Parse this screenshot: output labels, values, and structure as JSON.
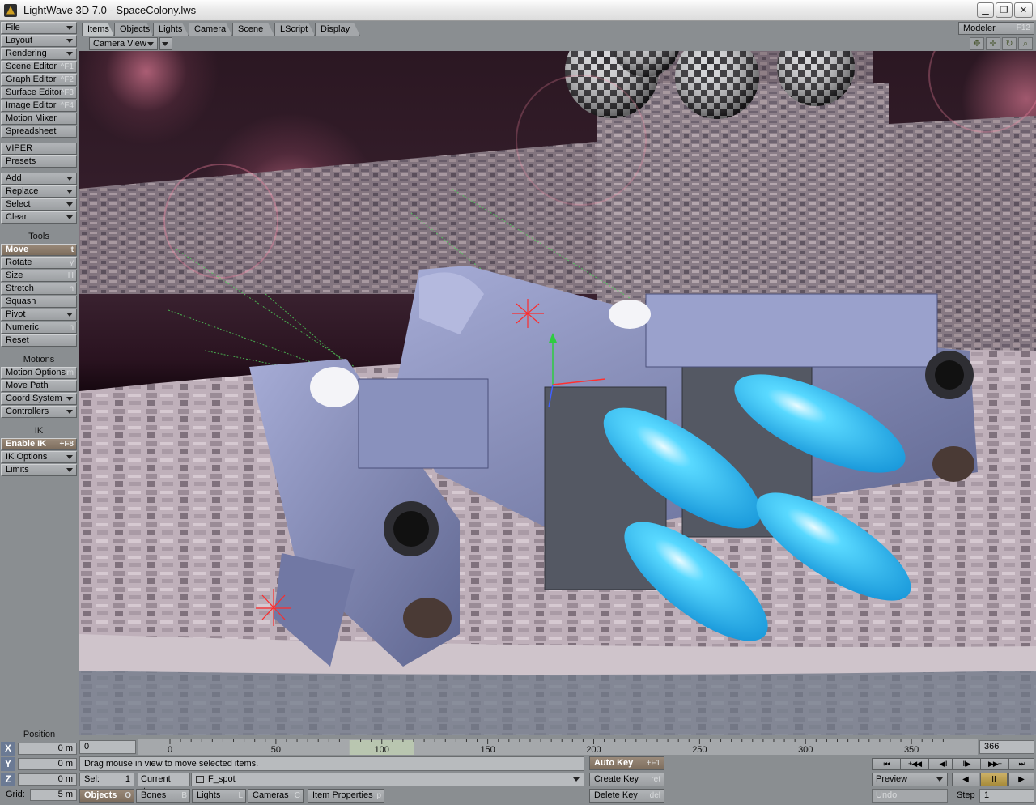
{
  "window": {
    "title": "LightWave 3D 7.0 - SpaceColony.lws"
  },
  "left_panel": {
    "menus": [
      {
        "label": "File",
        "type": "menu"
      },
      {
        "label": "Layout",
        "type": "menu"
      },
      {
        "label": "Rendering",
        "type": "menu"
      },
      {
        "label": "Scene Editor",
        "shortcut": "^F1"
      },
      {
        "label": "Graph Editor",
        "shortcut": "^F2"
      },
      {
        "label": "Surface Editor",
        "shortcut": "^F3"
      },
      {
        "label": "Image Editor",
        "shortcut": "^F4"
      },
      {
        "label": "Motion Mixer"
      },
      {
        "label": "Spreadsheet"
      },
      {
        "label": "VIPER"
      },
      {
        "label": "Presets"
      },
      {
        "label": "Add",
        "type": "menu"
      },
      {
        "label": "Replace",
        "type": "menu"
      },
      {
        "label": "Select",
        "type": "menu"
      },
      {
        "label": "Clear",
        "type": "menu"
      }
    ],
    "tools_header": "Tools",
    "tools": [
      {
        "label": "Move",
        "shortcut": "t",
        "active": true
      },
      {
        "label": "Rotate",
        "shortcut": "y"
      },
      {
        "label": "Size",
        "shortcut": "H"
      },
      {
        "label": "Stretch",
        "shortcut": "h"
      },
      {
        "label": "Squash"
      },
      {
        "label": "Pivot",
        "type": "menu"
      },
      {
        "label": "Numeric",
        "shortcut": "n"
      },
      {
        "label": "Reset"
      }
    ],
    "motions_header": "Motions",
    "motions": [
      {
        "label": "Motion Options",
        "shortcut": "m"
      },
      {
        "label": "Move Path"
      },
      {
        "label": "Coord System",
        "type": "menu"
      },
      {
        "label": "Controllers",
        "type": "menu"
      }
    ],
    "ik_header": "IK",
    "ik": [
      {
        "label": "Enable IK",
        "shortcut": "+F8",
        "active": true
      },
      {
        "label": "IK Options",
        "type": "menu"
      },
      {
        "label": "Limits",
        "type": "menu"
      }
    ]
  },
  "tabs": [
    "Items",
    "Objects",
    "Lights",
    "Camera",
    "Scene",
    "LScript",
    "Display"
  ],
  "active_tab": "Items",
  "modeler": {
    "label": "Modeler",
    "shortcut": "F12"
  },
  "view": {
    "selected": "Camera View"
  },
  "position": {
    "label": "Position",
    "x": {
      "axis": "X",
      "value": "0 m"
    },
    "y": {
      "axis": "Y",
      "value": "0 m"
    },
    "z": {
      "axis": "Z",
      "value": "0 m"
    },
    "grid": {
      "label": "Grid:",
      "value": "5 m"
    }
  },
  "timeline": {
    "start_frame": "0",
    "end_frame": "366",
    "ticks": [
      "0",
      "50",
      "100",
      "150",
      "200",
      "250",
      "300",
      "350"
    ],
    "current_frame": 100,
    "range_min": 0,
    "range_max": 366
  },
  "status": {
    "message": "Drag mouse in view to move selected items."
  },
  "keys": {
    "auto_key": {
      "label": "Auto Key",
      "shortcut": "+F1"
    },
    "create_key": {
      "label": "Create Key",
      "shortcut": "ret"
    },
    "delete_key": {
      "label": "Delete Key",
      "shortcut": "del"
    }
  },
  "selection": {
    "label": "Sel:",
    "count": "1",
    "current_item_label": "Current Item",
    "current_item": "F_spot"
  },
  "item_tabs": [
    {
      "label": "Objects",
      "shortcut": "O",
      "active": true
    },
    {
      "label": "Bones",
      "shortcut": "B"
    },
    {
      "label": "Lights",
      "shortcut": "L"
    },
    {
      "label": "Cameras",
      "shortcut": "C"
    },
    {
      "label": "Item Properties",
      "shortcut": "p"
    }
  ],
  "playback": {
    "preview": "Preview",
    "undo": "Undo",
    "step_label": "Step",
    "step_value": "1",
    "transport_top": [
      "⏮",
      "+◀◀",
      "◀II",
      "II▶",
      "▶▶+",
      "⏭"
    ],
    "transport_bottom": [
      "◀",
      "II",
      "▶"
    ]
  },
  "colors": {
    "panel_bg": "#8a8e91",
    "active_button": "#8c7c6c",
    "exhaust_glow": "#3fc9ff",
    "ship_hull": "#8790b8"
  }
}
